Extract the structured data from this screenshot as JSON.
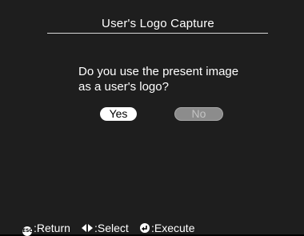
{
  "dialog": {
    "title": "User's Logo Capture",
    "prompt_line1": "Do you use the present image",
    "prompt_line2": "as a user's logo?",
    "yes_label": "Yes",
    "no_label": "No",
    "selected": "Yes"
  },
  "footer": {
    "return_icon": "esc-icon",
    "return_icon_text": "ESC",
    "return_label": ":Return",
    "select_icon": "left-right-arrows-icon",
    "select_label": ":Select",
    "execute_icon": "enter-icon",
    "execute_label": ":Execute"
  },
  "colors": {
    "background": "#1e1e1e",
    "text": "#ffffff",
    "selected_button_bg": "#ffffff",
    "selected_button_text": "#000000",
    "unselected_button_bg": "#8c8c8c",
    "unselected_button_text": "#c4c4c4"
  }
}
